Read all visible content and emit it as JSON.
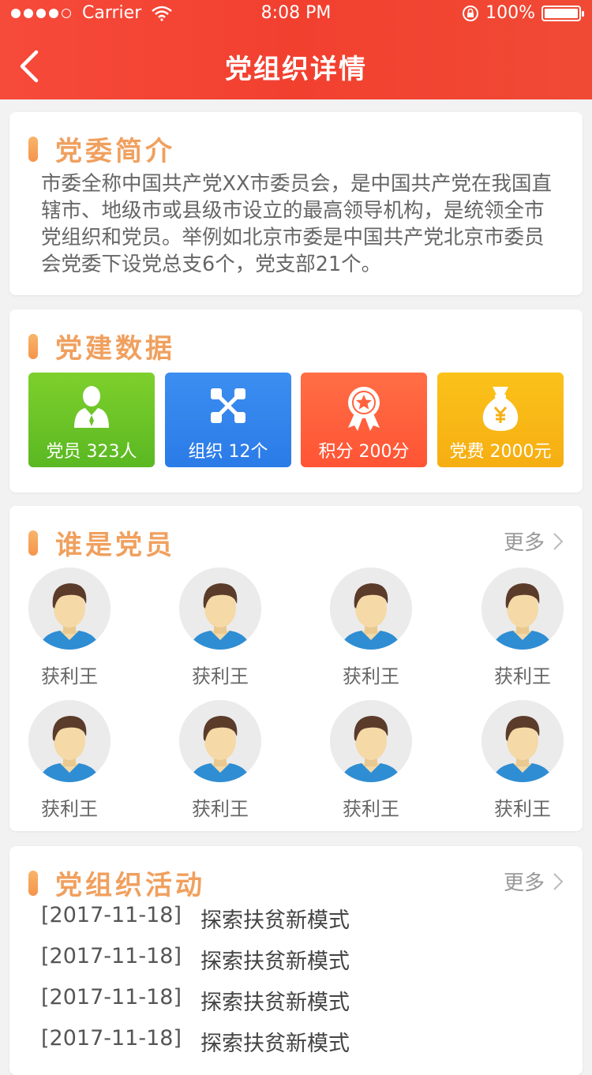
{
  "status_bar": {
    "carrier": "Carrier",
    "time": "8:08 PM",
    "battery": "100%"
  },
  "header": {
    "title": "党组织详情"
  },
  "intro": {
    "title": "党委简介",
    "text": "市委全称中国共产党XX市委员会，是中国共产党在我国直辖市、地级市或县级市设立的最高领导机构，是统领全市党组织和党员。举例如北京市委是中国共产党北京市委员会党委下设党总支6个，党支部21个。"
  },
  "stats": {
    "title": "党建数据",
    "tiles": [
      {
        "label": "党员 323人",
        "icon": "person-icon",
        "color": "#6cc427"
      },
      {
        "label": "组织 12个",
        "icon": "org-network-icon",
        "color": "#3386ee"
      },
      {
        "label": "积分 200分",
        "icon": "award-medal-icon",
        "color": "#ff623e"
      },
      {
        "label": "党费 2000元",
        "icon": "money-bag-icon",
        "color": "#f9b816"
      }
    ]
  },
  "members": {
    "title": "谁是党员",
    "more": "更多",
    "items": [
      {
        "name": "获利王"
      },
      {
        "name": "获利王"
      },
      {
        "name": "获利王"
      },
      {
        "name": "获利王"
      },
      {
        "name": "获利王"
      },
      {
        "name": "获利王"
      },
      {
        "name": "获利王"
      },
      {
        "name": "获利王"
      }
    ]
  },
  "activities": {
    "title": "党组织活动",
    "more": "更多",
    "items": [
      {
        "date": "[2017-11-18]",
        "title": "探索扶贫新模式"
      },
      {
        "date": "[2017-11-18]",
        "title": "探索扶贫新模式"
      },
      {
        "date": "[2017-11-18]",
        "title": "探索扶贫新模式"
      },
      {
        "date": "[2017-11-18]",
        "title": "探索扶贫新模式"
      }
    ]
  }
}
